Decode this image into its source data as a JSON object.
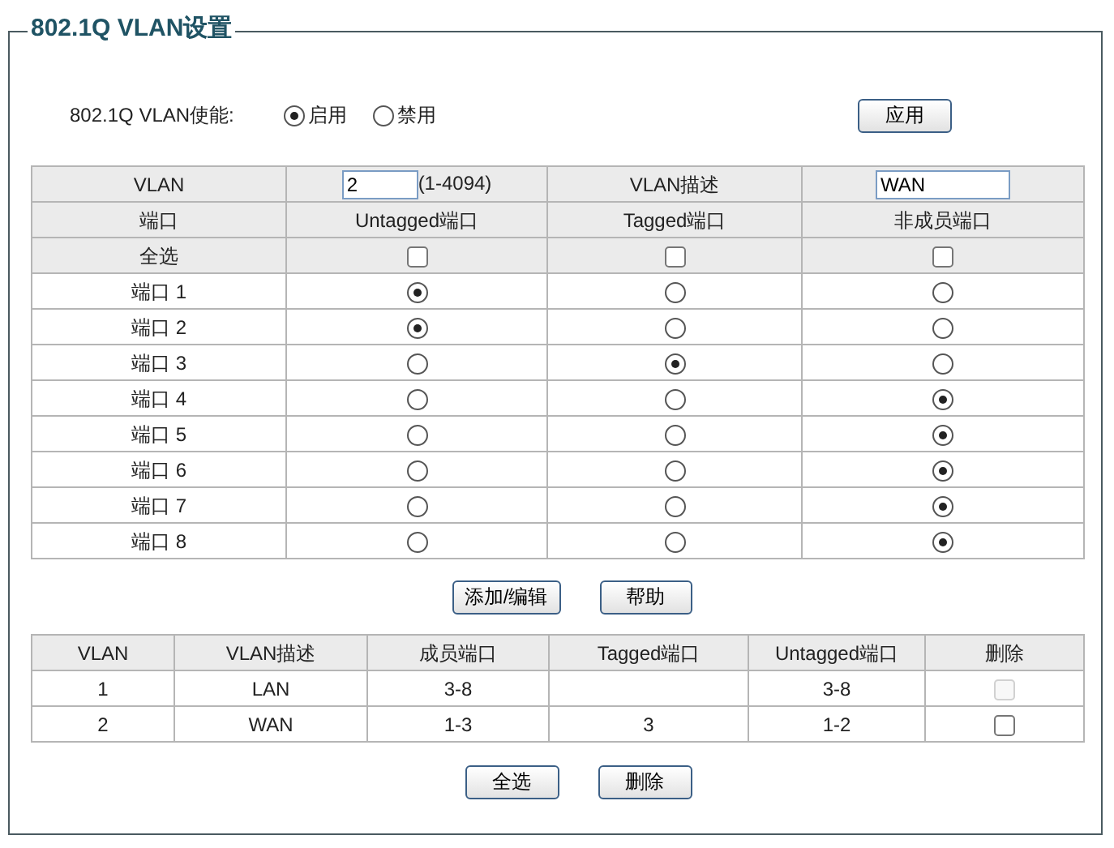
{
  "title": "802.1Q VLAN设置",
  "enable": {
    "label": "802.1Q VLAN使能:",
    "options": [
      {
        "label": "启用",
        "selected": true
      },
      {
        "label": "禁用",
        "selected": false
      }
    ],
    "apply_button": "应用"
  },
  "config_table": {
    "vlan_label": "VLAN",
    "vlan_value": "2",
    "vlan_range": "(1-4094)",
    "desc_label": "VLAN描述",
    "desc_value": "WAN",
    "columns": [
      "端口",
      "Untagged端口",
      "Tagged端口",
      "非成员端口"
    ],
    "select_all": {
      "label": "全选",
      "untagged": false,
      "tagged": false,
      "non_member": false
    },
    "ports": [
      {
        "label": "端口 1",
        "untagged": true,
        "tagged": false,
        "non_member": false
      },
      {
        "label": "端口 2",
        "untagged": true,
        "tagged": false,
        "non_member": false
      },
      {
        "label": "端口 3",
        "untagged": false,
        "tagged": true,
        "non_member": false
      },
      {
        "label": "端口 4",
        "untagged": false,
        "tagged": false,
        "non_member": true
      },
      {
        "label": "端口 5",
        "untagged": false,
        "tagged": false,
        "non_member": true
      },
      {
        "label": "端口 6",
        "untagged": false,
        "tagged": false,
        "non_member": true
      },
      {
        "label": "端口 7",
        "untagged": false,
        "tagged": false,
        "non_member": true
      },
      {
        "label": "端口 8",
        "untagged": false,
        "tagged": false,
        "non_member": true
      }
    ]
  },
  "middle_buttons": [
    "添加/编辑",
    "帮助"
  ],
  "list_table": {
    "columns": [
      "VLAN",
      "VLAN描述",
      "成员端口",
      "Tagged端口",
      "Untagged端口",
      "删除"
    ],
    "rows": [
      {
        "cells": [
          "1",
          "LAN",
          "3-8",
          "",
          "3-8"
        ],
        "delete_checked": false,
        "delete_disabled": true
      },
      {
        "cells": [
          "2",
          "WAN",
          "1-3",
          "3",
          "1-2"
        ],
        "delete_checked": false,
        "delete_disabled": false
      }
    ]
  },
  "bottom_buttons": [
    "全选",
    "删除"
  ]
}
